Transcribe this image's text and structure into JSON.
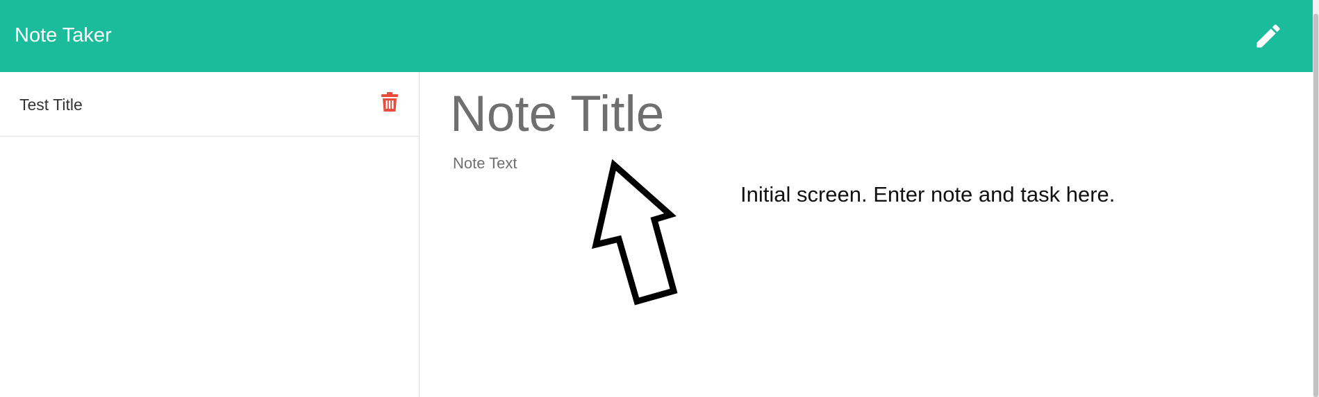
{
  "app": {
    "title": "Note Taker",
    "accent_color": "#1abc9c"
  },
  "header": {
    "new_note_icon": "pencil-icon"
  },
  "sidebar": {
    "notes": [
      {
        "title": "Test Title",
        "delete_icon": "trash-icon",
        "delete_icon_color": "#e74c3c"
      }
    ]
  },
  "editor": {
    "title_placeholder": "Note Title",
    "text_placeholder": "Note Text"
  },
  "annotation": {
    "caption": "Initial screen. Enter note and task here.",
    "arrow_icon": "up-arrow-icon"
  }
}
